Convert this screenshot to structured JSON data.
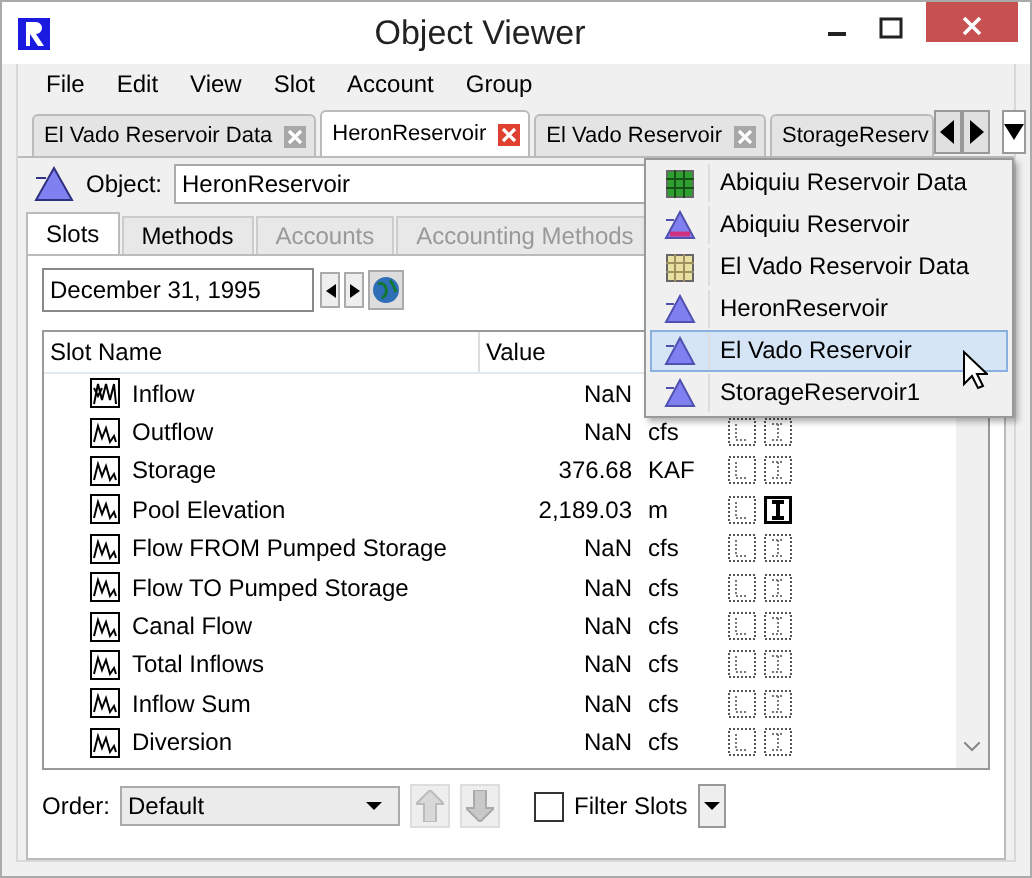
{
  "window": {
    "title": "Object Viewer"
  },
  "menu": [
    "File",
    "Edit",
    "View",
    "Slot",
    "Account",
    "Group"
  ],
  "object_tabs": [
    {
      "label": "El Vado Reservoir Data",
      "selected": false
    },
    {
      "label": "HeronReservoir",
      "selected": true
    },
    {
      "label": "El Vado Reservoir",
      "selected": false
    },
    {
      "label": "StorageReserv",
      "selected": false
    }
  ],
  "object": {
    "label": "Object:",
    "value": "HeronReservoir"
  },
  "view_tabs": [
    {
      "label": "Slots",
      "selected": true,
      "disabled": false
    },
    {
      "label": "Methods",
      "selected": false,
      "disabled": false
    },
    {
      "label": "Accounts",
      "selected": false,
      "disabled": true
    },
    {
      "label": "Accounting Methods",
      "selected": false,
      "disabled": true
    }
  ],
  "date": "December 31, 1995",
  "table": {
    "columns": [
      "Slot Name",
      "Value"
    ],
    "rows": [
      {
        "name": "Inflow",
        "value": "NaN",
        "kind": "multi"
      },
      {
        "name": "Outflow",
        "value": "NaN",
        "unit": "cfs",
        "kind": "series",
        "input_flag": false
      },
      {
        "name": "Storage",
        "value": "376.68",
        "unit": "KAF",
        "kind": "series",
        "input_flag": false
      },
      {
        "name": "Pool Elevation",
        "value": "2,189.03",
        "unit": "m",
        "kind": "series",
        "input_flag": true
      },
      {
        "name": "Flow FROM Pumped Storage",
        "value": "NaN",
        "unit": "cfs",
        "kind": "series",
        "input_flag": false
      },
      {
        "name": "Flow TO Pumped Storage",
        "value": "NaN",
        "unit": "cfs",
        "kind": "series",
        "input_flag": false
      },
      {
        "name": "Canal Flow",
        "value": "NaN",
        "unit": "cfs",
        "kind": "series",
        "input_flag": false
      },
      {
        "name": "Total Inflows",
        "value": "NaN",
        "unit": "cfs",
        "kind": "series",
        "input_flag": false
      },
      {
        "name": "Inflow Sum",
        "value": "NaN",
        "unit": "cfs",
        "kind": "series",
        "input_flag": false
      },
      {
        "name": "Diversion",
        "value": "NaN",
        "unit": "cfs",
        "kind": "series",
        "input_flag": false
      }
    ]
  },
  "order": {
    "label": "Order:",
    "value": "Default"
  },
  "filter": {
    "label": "Filter Slots",
    "checked": false
  },
  "popup": [
    {
      "label": "Abiquiu Reservoir Data",
      "kind": "data",
      "selected": false
    },
    {
      "label": "Abiquiu Reservoir",
      "kind": "reservoir-alt",
      "selected": false
    },
    {
      "label": "El Vado Reservoir Data",
      "kind": "data-alt",
      "selected": false
    },
    {
      "label": "HeronReservoir",
      "kind": "reservoir",
      "selected": false
    },
    {
      "label": "El Vado Reservoir",
      "kind": "reservoir",
      "selected": true
    },
    {
      "label": "StorageReservoir1",
      "kind": "reservoir",
      "selected": false
    }
  ]
}
